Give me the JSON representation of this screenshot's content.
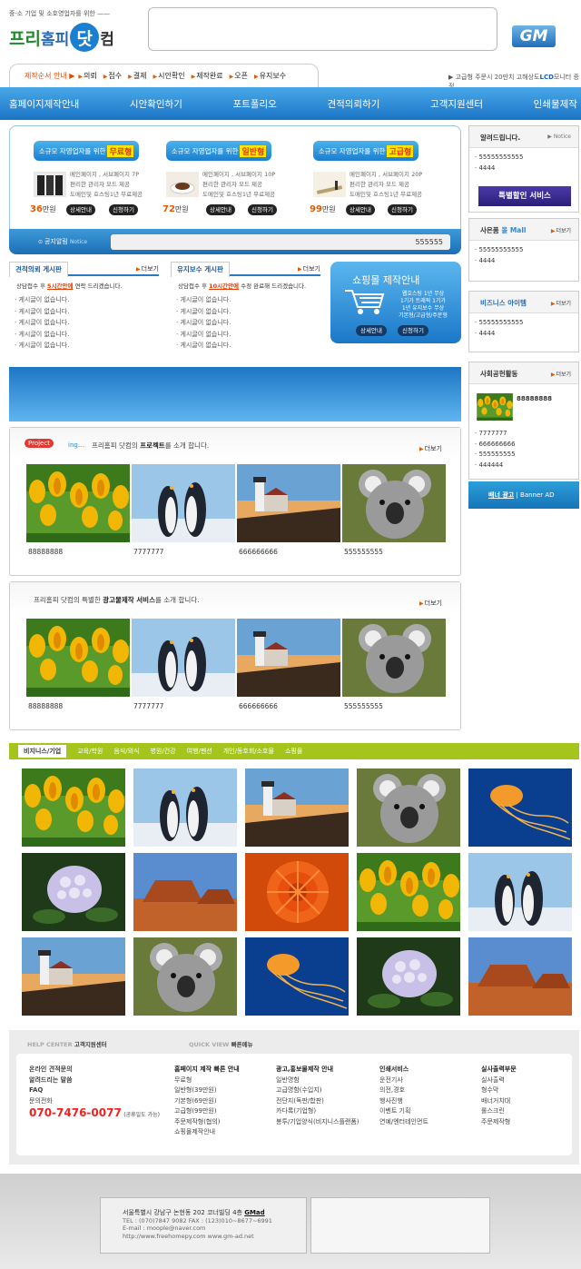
{
  "header": {
    "slogan": "중·소 기업 및 소호영업자를 위한 ——",
    "logo_part1": "프리",
    "logo_part2": "홈피",
    "logo_dot": "닷",
    "logo_part3": "컴",
    "gm_logo": "GM"
  },
  "order_bar": {
    "lead": "제작순서 안내 ▶",
    "steps": [
      "의뢰",
      "접수",
      "결제",
      "시안확인",
      "제작완료",
      "오픈",
      "유지보수"
    ]
  },
  "right_news": {
    "text": "▶ 고급형 주문시 20만치 고해상도",
    "lcd": "LCD",
    "tail": "모니터 증정"
  },
  "nav": [
    "홈페이지제작안내",
    "시안확인하기",
    "포트폴리오",
    "견적의뢰하기",
    "고객지원센터",
    "인쇄물제작"
  ],
  "packages": [
    {
      "title": "소규모 자영업자를 위한",
      "badge": "무료형",
      "desc": [
        "메인페이지 , 서브페이지 7P",
        "편리한 관리자 모드 제공",
        "도메인및 호스팅1년 무료제공"
      ],
      "price": "36",
      "unit": "만원",
      "btn1": "상세안내",
      "btn2": "신청하기"
    },
    {
      "title": "소규모 자영업자를 위한",
      "badge": "일반형",
      "desc": [
        "메인페이지 , 서브페이지 10P",
        "편리한 관리자 모드 제공",
        "도메인및 호스팅1년 무료제공"
      ],
      "price": "72",
      "unit": "만원",
      "btn1": "상세안내",
      "btn2": "신청하기"
    },
    {
      "title": "소규모 자영업자를 위한",
      "badge": "고급형",
      "desc": [
        "메인페이지 , 서브페이지 20P",
        "편리한 관리자 모드 제공",
        "도메인및 호스팅1년 무료제공"
      ],
      "price": "99",
      "unit": "만원",
      "btn1": "상세안내",
      "btn2": "신청하기"
    }
  ],
  "notice": {
    "label": "공지알림",
    "sub": "Notice",
    "value": "555555"
  },
  "boards": [
    {
      "title": "견적의뢰 게시판",
      "more": "더보기",
      "info_pre": "상담접수 후",
      "info_hl": "5시간안에",
      "info_post": "연락 드리겠습니다.",
      "items": [
        "게시글이 없습니다.",
        "게시글이 없습니다.",
        "게시글이 없습니다.",
        "게시글이 없습니다.",
        "게시글이 없습니다."
      ]
    },
    {
      "title": "유지보수 게시판",
      "more": "더보기",
      "info_pre": "상담접수 후",
      "info_hl": "10시간안에",
      "info_post": "수정 완료해 드리겠습니다.",
      "items": [
        "게시글이 없습니다.",
        "게시글이 없습니다.",
        "게시글이 없습니다.",
        "게시글이 없습니다.",
        "게시글이 없습니다."
      ]
    }
  ],
  "shop": {
    "title": "쇼핑몰 제작안내",
    "desc": [
      "웹호스팅 1년 무상",
      "1기가 트래픽 1기가",
      "1년 유지보수 무상",
      "기본형/고급형/주문형"
    ],
    "btn1": "상세안내",
    "btn2": "신청하기"
  },
  "project": {
    "logo": "Project",
    "logo_sub": "ing...",
    "text_pre": "프리홈피 닷컴의",
    "text_b": "프로젝트",
    "text_post": "를 소개 합니다.",
    "more": "더보기",
    "captions": [
      "88888888",
      "7777777",
      "666666666",
      "555555555"
    ]
  },
  "ad_section": {
    "text_pre": "프리홈피 닷컴의 특별한",
    "text_b": "광고물제작 서비스",
    "text_post": "를 소개 합니다.",
    "more": "더보기",
    "captions": [
      "88888888",
      "7777777",
      "666666666",
      "555555555"
    ]
  },
  "sidebar": {
    "notice": {
      "title": "알려드립니다.",
      "more": "▶ Notice",
      "items": [
        "55555555555",
        "4444"
      ],
      "special": "특별할인 서비스"
    },
    "mall": {
      "title": "사은품",
      "accent": "몰 Mall",
      "more": "더보기",
      "items": [
        "55555555555",
        "4444"
      ]
    },
    "biz": {
      "title": "비즈니스 아이템",
      "more": "더보기",
      "items": [
        "55555555555",
        "4444"
      ]
    },
    "social": {
      "title": "사회공헌활동",
      "more": "더보기",
      "caption": "88888888",
      "items": [
        "7777777",
        "666666666",
        "555555555",
        "444444"
      ]
    },
    "banner": {
      "label": "배너 광고",
      "sub": "Banner AD"
    }
  },
  "categories": {
    "active": "비지니스/기업",
    "items": [
      "교육/학원",
      "음식/외식",
      "병원/건강",
      "여행/펜션",
      "개인/동호회/소호몰",
      "쇼핑몰"
    ]
  },
  "gallery": [
    "tulip",
    "penguin",
    "lighthouse",
    "koala",
    "jellyfish",
    "hydrangea",
    "desert",
    "chrysanthemum",
    "tulip",
    "penguin",
    "lighthouse",
    "koala",
    "jellyfish",
    "hydrangea",
    "desert"
  ],
  "footer": {
    "help": "HELP CENTER",
    "help_b": "고객지원센터",
    "quick": "QUICK VIEW",
    "quick_b": "빠른메뉴",
    "col1": [
      "온라인 견적문의",
      "알려드리는 말씀",
      "FAQ",
      "문의전화"
    ],
    "phone": "070-7476-0077",
    "phone_note": "(공휴일도 가능)",
    "col2": {
      "h": "홈페이지 제작 빠른 안내",
      "items": [
        "무료형",
        "일반형(39만원)",
        "기본형(69만원)",
        "고급형(99만원)",
        "주문제작형(협의)",
        "쇼핑몰제작안내"
      ]
    },
    "col3": {
      "h": "광고,홍보물제작 안내",
      "items": [
        "일반명함",
        "고급명함(수입지)",
        "전단지(독판/합판)",
        "카다록(기업형)",
        "봉투/기업양식(비지니스플랜폼)"
      ]
    },
    "col4": {
      "h": "인쇄서비스",
      "items": [
        "운전기사",
        "의전,경호",
        "행사진행",
        "이벤트 기획",
        "연예/엔터테인먼트"
      ]
    },
    "col5": {
      "h": "실사출력부문",
      "items": [
        "실사출력",
        "형수막",
        "배너거치대",
        "롤스크린",
        "주문제작형"
      ]
    }
  },
  "address": {
    "line1": "서울특별시 강남구 논현동 202 코너빌딩 4층",
    "company": "GMad",
    "tel": "TEL : (070)7847 9082    FAX : (123)010~8677~6991",
    "email": "E-mail : moople@naver.com",
    "urls": "http://www.freehomepy.com    www.gm-ad.net"
  }
}
